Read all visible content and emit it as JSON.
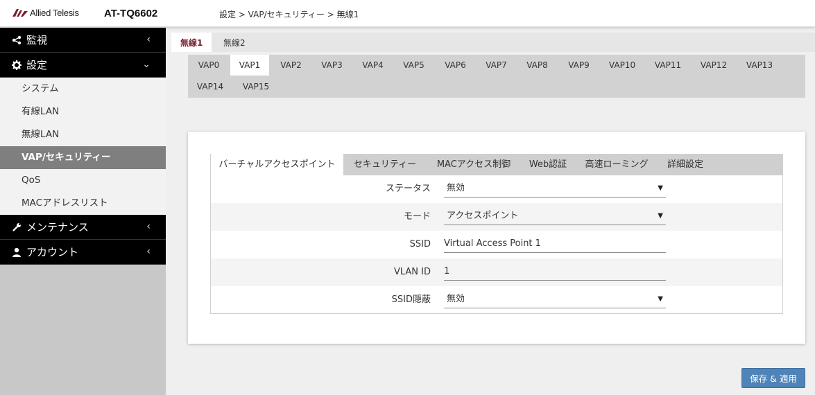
{
  "header": {
    "brand": "Allied Telesis",
    "model": "AT-TQ6602",
    "breadcrumb": "設定 > VAP/セキュリティー > 無線1"
  },
  "sidebar": {
    "items": [
      {
        "label": "監視",
        "icon": "share-icon",
        "chevron": "‹"
      },
      {
        "label": "設定",
        "icon": "gear-icon",
        "chevron": "⌄"
      },
      {
        "label": "メンテナンス",
        "icon": "wrench-icon",
        "chevron": "‹"
      },
      {
        "label": "アカウント",
        "icon": "user-icon",
        "chevron": "‹"
      }
    ],
    "submenu": [
      {
        "label": "システム"
      },
      {
        "label": "有線LAN"
      },
      {
        "label": "無線LAN"
      },
      {
        "label": "VAP/セキュリティー",
        "active": true
      },
      {
        "label": "QoS"
      },
      {
        "label": "MACアドレスリスト"
      }
    ]
  },
  "radio_tabs": [
    {
      "label": "無線1",
      "active": true
    },
    {
      "label": "無線2",
      "active": false
    }
  ],
  "vap_tabs": [
    "VAP0",
    "VAP1",
    "VAP2",
    "VAP3",
    "VAP4",
    "VAP5",
    "VAP6",
    "VAP7",
    "VAP8",
    "VAP9",
    "VAP10",
    "VAP11",
    "VAP12",
    "VAP13",
    "VAP14",
    "VAP15"
  ],
  "vap_active": "VAP1",
  "sub_tabs": [
    "バーチャルアクセスポイント",
    "セキュリティー",
    "MACアクセス制御",
    "Web認証",
    "高速ローミング",
    "詳細設定"
  ],
  "sub_tab_active": "バーチャルアクセスポイント",
  "form": {
    "rows": [
      {
        "label": "ステータス",
        "value": "無効",
        "type": "select"
      },
      {
        "label": "モード",
        "value": "アクセスポイント",
        "type": "select"
      },
      {
        "label": "SSID",
        "value": "Virtual Access Point 1",
        "type": "text"
      },
      {
        "label": "VLAN ID",
        "value": "1",
        "type": "text"
      },
      {
        "label": "SSID隠蔽",
        "value": "無効",
        "type": "select"
      }
    ]
  },
  "save_button": "保存 & 適用",
  "colors": {
    "accent": "#7a1c2e",
    "button": "#4f84b8",
    "sidebar_header": "#000000",
    "active_submenu": "#7f7f7f"
  }
}
